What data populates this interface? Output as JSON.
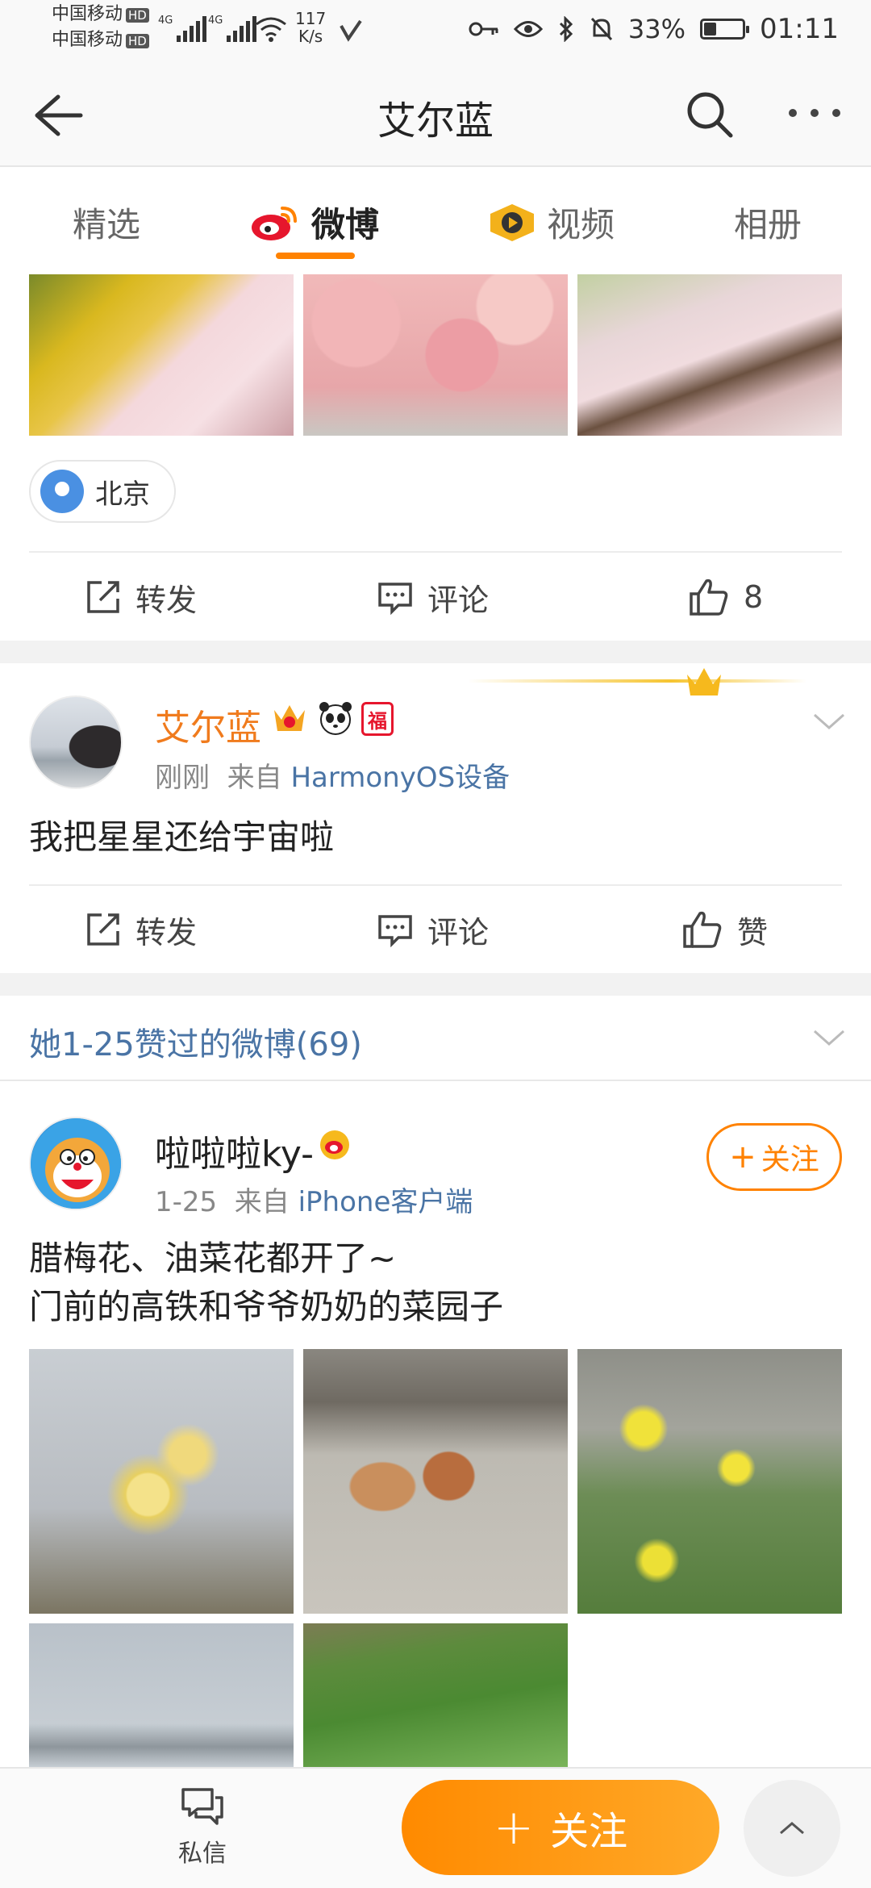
{
  "status_bar": {
    "carrier1": "中国移动",
    "carrier2": "中国移动",
    "hd": "HD",
    "net_type": "4G",
    "speed_value": "117",
    "speed_unit": "K/s",
    "battery": "33%",
    "battery_level": 0.33,
    "time": "01:11"
  },
  "header": {
    "title": "艾尔蓝"
  },
  "tabs": [
    {
      "label": "精选"
    },
    {
      "label": "微博"
    },
    {
      "label": "视频"
    },
    {
      "label": "相册"
    }
  ],
  "post1": {
    "location": "北京",
    "actions": {
      "repost": "转发",
      "comment": "评论",
      "like_count": "8"
    }
  },
  "post2": {
    "username": "艾尔蓝",
    "time": "刚刚",
    "from": "来自",
    "source": "HarmonyOS设备",
    "text": "我把星星还给宇宙啦",
    "actions": {
      "repost": "转发",
      "comment": "评论",
      "like": "赞"
    },
    "badge_fu": "福"
  },
  "liked_section": {
    "title": "她1-25赞过的微博(69)"
  },
  "post3": {
    "username": "啦啦啦ky-",
    "date": "1-25",
    "from": "来自",
    "source": "iPhone客户端",
    "follow": "关注",
    "text_line1": "腊梅花、油菜花都开了~",
    "text_line2": "门前的高铁和爷爷奶奶的菜园子"
  },
  "bottom_bar": {
    "message": "私信",
    "follow": "关注"
  },
  "colors": {
    "accent": "#ff8200",
    "link": "#4a74a5",
    "username_vip": "#f07b1d"
  }
}
